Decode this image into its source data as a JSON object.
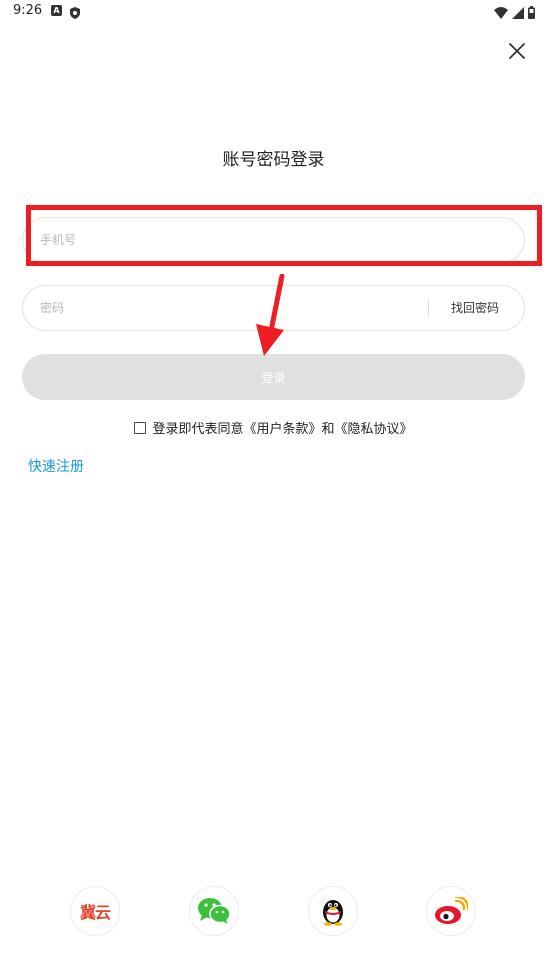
{
  "status_bar": {
    "time": "9:26",
    "left_icons": [
      "a-icon",
      "shield-icon"
    ],
    "right_icons": [
      "wifi-icon",
      "signal-icon",
      "battery-icon"
    ]
  },
  "header": {
    "close_icon": "close-icon",
    "title": "账号密码登录"
  },
  "form": {
    "phone_placeholder": "手机号",
    "phone_value": "",
    "password_placeholder": "密码",
    "password_value": "",
    "find_password_label": "找回密码",
    "login_label": "登录"
  },
  "agreement": {
    "checked": false,
    "prefix": "登录即代表同意",
    "terms": "《用户条款》",
    "and": "和",
    "privacy": "《隐私协议》"
  },
  "quick_register_label": "快速注册",
  "social_logins": [
    {
      "name": "jiyun",
      "text": "冀云",
      "icon": "jiyun-logo-icon",
      "color": "#e0452b"
    },
    {
      "name": "wechat",
      "icon": "wechat-icon",
      "color": "#3bbf3c"
    },
    {
      "name": "qq",
      "icon": "qq-penguin-icon",
      "color": "#111111"
    },
    {
      "name": "weibo",
      "icon": "weibo-icon",
      "color": "#e6162d"
    }
  ],
  "annotation": {
    "highlight_color": "#ee1c23",
    "highlight_target": "phone-field",
    "arrow_color": "#ee1c23"
  }
}
